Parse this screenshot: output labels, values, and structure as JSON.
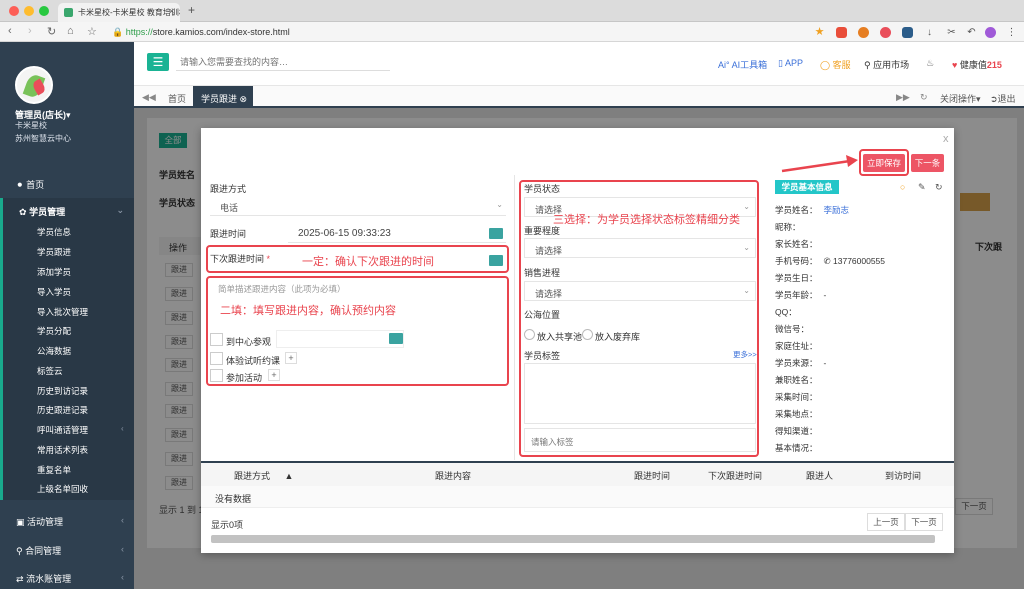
{
  "browser": {
    "tab_title": "卡米星校-卡米星校 教育培训机",
    "tab_close": "✕",
    "new_tab": "+",
    "url_scheme": "https://",
    "url_rest": "store.kamios.com/index-store.html"
  },
  "header": {
    "search_placeholder": "请输入您需要查找的内容…",
    "links": [
      {
        "label": "AI工具箱",
        "icon": "ai-icon",
        "color": "#3a6fd8"
      },
      {
        "label": "APP",
        "icon": "phone-icon",
        "color": "#3a6fd8"
      },
      {
        "label": "客服",
        "icon": "headset-icon",
        "color": "#f0a020"
      },
      {
        "label": "应用市场",
        "icon": "cart-icon",
        "color": "#333333"
      },
      {
        "label": "健康值",
        "icon": "heart-icon",
        "color": "#333333"
      }
    ],
    "health_value": "215",
    "menu_icon": "☰"
  },
  "sidebar": {
    "user_name": "管理员(店长)▾",
    "school": "卡米星校",
    "center": "苏州智慧云中心",
    "home": "首页",
    "student_mgmt": "学员管理",
    "sub_items": [
      "学员信息",
      "学员跟进",
      "添加学员",
      "导入学员",
      "导入批次管理",
      "学员分配",
      "公海数据",
      "标签云",
      "历史到访记录",
      "历史跟进记录",
      "呼叫通话管理",
      "常用话术列表",
      "重复名单",
      "上级名单回收"
    ],
    "activity": "活动管理",
    "contract": "合同管理",
    "cashflow": "流水账管理"
  },
  "page_tabs": {
    "home": "首页",
    "active": "学员跟进",
    "close_ops": "关闭操作▾",
    "logout": "退出"
  },
  "background": {
    "all_btn": "全部",
    "student_name": "学员姓名",
    "student_status": "学员状态",
    "ops_col": "操作",
    "row_btn": "跟进",
    "next_follow_col": "下次跟",
    "showing": "显示 1 到 1",
    "next_page": "下一页"
  },
  "modal": {
    "close": "x",
    "follow_method_label": "跟进方式",
    "follow_method_value": "电话",
    "follow_time_label": "跟进时间",
    "follow_time_value": "2025-06-15 09:33:23",
    "next_time_label": "下次跟进时间",
    "required_mark": "*",
    "annotation_1": "一定：确认下次跟进的时间",
    "content_placeholder": "简单描述跟进内容（此项为必填）",
    "annotation_2": "二填：填写跟进内容，确认预约内容",
    "visit_label": "到中心参观",
    "trial_label": "体验试听约课",
    "event_label": "参加活动",
    "plus": "+",
    "status_label": "学员状态",
    "status_value": "请选择",
    "annotation_3": "三选择：为学员选择状态标签精细分类",
    "importance_label": "重要程度",
    "importance_value": "请选择",
    "sales_label": "销售进程",
    "sales_value": "请选择",
    "sea_label": "公海位置",
    "sea_option_1": "放入共享池",
    "sea_option_2": "放入废弃库",
    "tags_label": "学员标签",
    "more": "更多>>",
    "tag_input_placeholder": "请输入标签",
    "save_btn": "立即保存",
    "next_btn": "下一条",
    "info_title": "学员基本信息",
    "info": {
      "name_label": "学员姓名：",
      "name_value": "李励志",
      "nickname_label": "昵称：",
      "parent_label": "家长姓名：",
      "phone_label": "手机号码：",
      "phone_value": "13776000555",
      "birthday_label": "学员生日：",
      "age_label": "学员年龄：",
      "age_value": "-",
      "qq_label": "QQ：",
      "wechat_label": "微信号：",
      "address_label": "家庭住址：",
      "source_label": "学员来源：",
      "source_value": "-",
      "part_time_label": "兼职姓名：",
      "collect_time_label": "采集时间：",
      "collect_place_label": "采集地点：",
      "channel_label": "得知渠道：",
      "basic_label": "基本情况："
    },
    "table": {
      "headers": [
        "跟进方式",
        "跟进内容",
        "跟进时间",
        "下次跟进时间",
        "跟进人",
        "到访时间"
      ],
      "sort_icon": "▲",
      "empty": "没有数据",
      "count": "显示0项",
      "prev": "上一页",
      "next": "下一页"
    }
  },
  "colors": {
    "accent": "#1ab394",
    "sidebar": "#2f4050",
    "annotation": "#e9444e"
  }
}
